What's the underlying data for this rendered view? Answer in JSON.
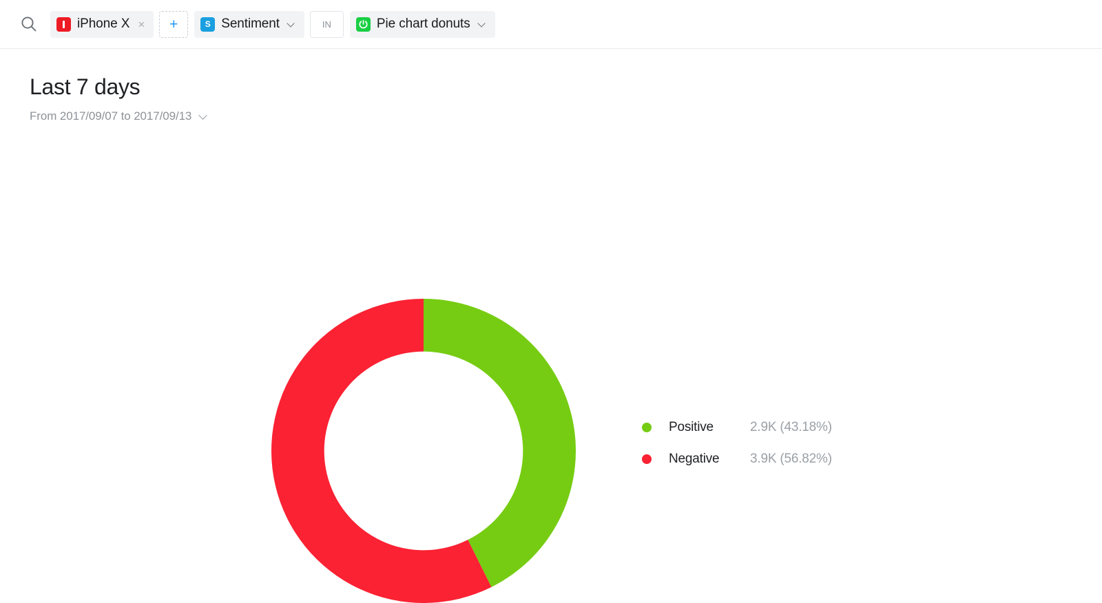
{
  "query_bar": {
    "search_icon": "search-icon",
    "chips": [
      {
        "badge_icon": "flag-icon",
        "badge_letter": "I",
        "badge_color": "#ed1c24",
        "label": "iPhone X",
        "close_glyph": "×"
      }
    ],
    "add_button_label": "+",
    "field_chip": {
      "badge_icon": "sentiment-icon",
      "badge_letter": "S",
      "badge_color": "#1a9fe0",
      "label": "Sentiment",
      "caret_icon": "chevron-down-icon"
    },
    "operator_label": "IN",
    "value_chip": {
      "badge_icon": "donut-chart-icon",
      "badge_letter": "⏻",
      "badge_color": "#19cf43",
      "label": "Pie chart donuts",
      "caret_icon": "chevron-down-icon"
    }
  },
  "header": {
    "title": "Last 7 days",
    "date_range": "From 2017/09/07 to 2017/09/13",
    "date_caret_icon": "chevron-down-icon"
  },
  "chart_data": {
    "type": "pie",
    "variant": "donut",
    "title": "Last 7 days",
    "legend_position": "right",
    "start_angle": 0,
    "direction": "clockwise",
    "inner_radius_ratio": 0.653,
    "labels": [
      "Positive",
      "Negative"
    ],
    "values": [
      2900,
      3900
    ],
    "value_labels": [
      "2.9K",
      "3.9K"
    ],
    "percents": [
      43.18,
      56.82
    ],
    "percent_labels": [
      "(43.18%)",
      "(56.82%)"
    ],
    "colors": [
      "#76cc12",
      "#fa2233"
    ],
    "slices": [
      {
        "label": "Positive",
        "value": 2900,
        "value_label": "2.9K",
        "percent": 43.18,
        "percent_label": "(43.18%)",
        "display_value": "2.9K (43.18%)",
        "color": "#76cc12"
      },
      {
        "label": "Negative",
        "value": 3900,
        "value_label": "3.9K",
        "percent": 56.82,
        "percent_label": "(56.82%)",
        "display_value": "3.9K (56.82%)",
        "color": "#fa2233"
      }
    ]
  }
}
